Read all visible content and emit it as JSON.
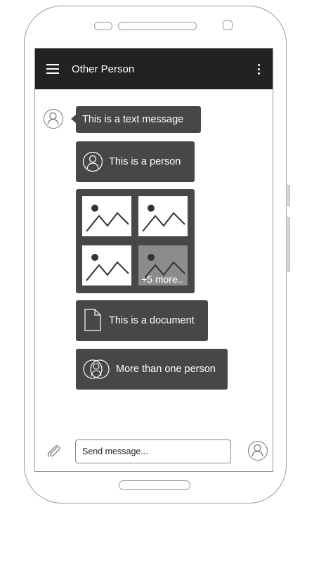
{
  "header": {
    "title": "Other Person"
  },
  "messages": {
    "text": "This is a text message",
    "person": "This is a person",
    "gallery": {
      "more_label": "+5 more.."
    },
    "document": "This is a document",
    "group": "More than one person"
  },
  "composer": {
    "placeholder": "Send message..."
  },
  "icons": {
    "menu": "hamburger-menu-icon",
    "overflow": "more-vert-icon",
    "attach": "paperclip-icon",
    "avatar": "person-avatar-icon",
    "document": "document-icon",
    "group": "group-icon",
    "image": "image-placeholder-icon"
  },
  "colors": {
    "appbar": "#222222",
    "bubble": "#474747"
  }
}
